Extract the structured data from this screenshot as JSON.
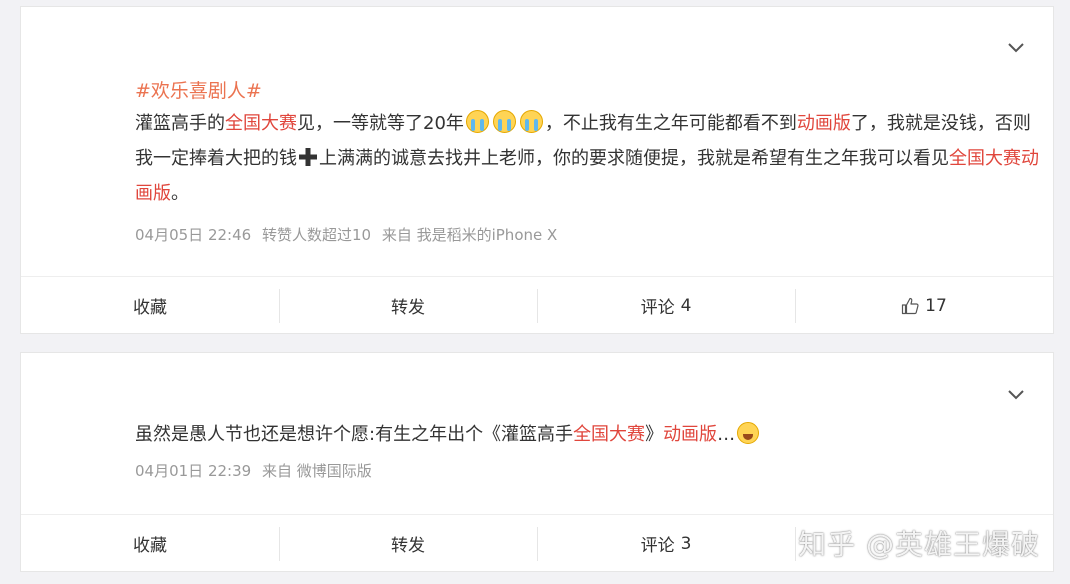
{
  "posts": [
    {
      "topic": "#欢乐喜剧人#",
      "content": {
        "s1": "灌篮高手的",
        "r1": "全国大赛",
        "s2": "见，一等就等了20年",
        "s3": "，不止我有生之年可能都看不到",
        "r2": "动画版",
        "s4": "了，我就是没钱，否则我一定捧着大把的钱",
        "s5": "上满满的诚意去找井上老师，你的要求随便提，我就是希望有生之年我可以看见",
        "r3": "全国大赛动画版",
        "s6": "。"
      },
      "meta": {
        "time": "04月05日 22:46",
        "reposts": "转赞人数超过10",
        "source": "来自 我是稻米的iPhone X"
      },
      "actions": {
        "favorite": "收藏",
        "repost": "转发",
        "comment": "评论",
        "comment_count": "4",
        "like_count": "17"
      }
    },
    {
      "content": {
        "s1": "虽然是愚人节也还是想许个愿:有生之年出个《灌篮高手",
        "r1": "全国大赛",
        "s2": "》",
        "r2": "动画版",
        "s3": "…"
      },
      "meta": {
        "time": "04月01日 22:39",
        "source": "来自 微博国际版"
      },
      "actions": {
        "favorite": "收藏",
        "repost": "转发",
        "comment": "评论",
        "comment_count": "3"
      }
    }
  ],
  "icons": {
    "expand": "chevron-down-icon",
    "cry": "crying-face-emoji",
    "plus": "heavy-plus-emoji",
    "laugh": "laughing-face-emoji",
    "like": "thumbs-up-icon"
  },
  "colors": {
    "accent_link": "#e0463c",
    "topic": "#eb7350",
    "meta": "#999999"
  },
  "watermark": "知乎 @英雄王爆破"
}
